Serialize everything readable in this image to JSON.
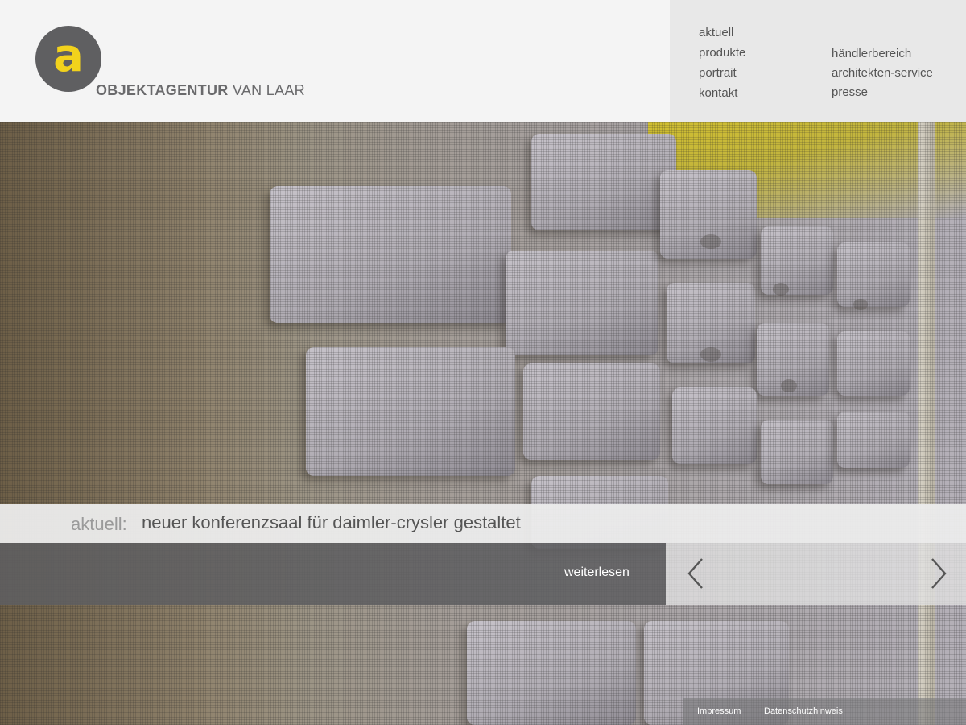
{
  "logo": {
    "letter": "a",
    "brand_bold": "OBJEKTAGENTUR",
    "brand_light": " VAN LAAR"
  },
  "nav": {
    "primary": [
      {
        "label": "aktuell"
      },
      {
        "label": "produkte"
      },
      {
        "label": "portrait"
      },
      {
        "label": "kontakt"
      }
    ],
    "secondary": [
      {
        "label": "händlerbereich"
      },
      {
        "label": "architekten-service"
      },
      {
        "label": "presse"
      }
    ]
  },
  "news": {
    "label": "aktuell:",
    "title": "neuer konferenzsaal für daimler-crysler gestaltet",
    "read_more": "weiterlesen"
  },
  "slider": {
    "prev_icon": "chevron-left-icon",
    "next_icon": "chevron-right-icon"
  },
  "footer": {
    "impressum": "Impressum",
    "datenschutz": "Datenschutzhinweis"
  },
  "colors": {
    "accent_yellow": "#f2d21c",
    "logo_gray": "#5f5f61",
    "header_bg": "#f4f4f4",
    "nav_bg": "#e8e8e8"
  }
}
